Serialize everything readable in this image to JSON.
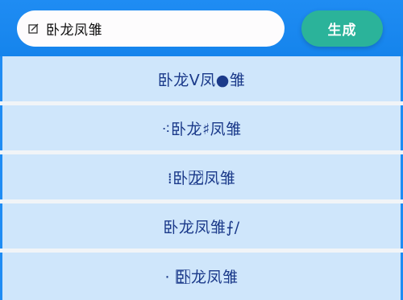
{
  "search": {
    "value": "卧龙凤雏"
  },
  "generate_button": {
    "label": "生成"
  },
  "results": [
    {
      "text": "卧龙ᐯ凤●雏"
    },
    {
      "text": "⁖卧龙♯凤雏"
    },
    {
      "text": "⁞卧龙⃞凤雏"
    },
    {
      "text": "卧龙凤雏⨍/"
    },
    {
      "text": "· 卧⃞龙凤雏"
    }
  ],
  "colors": {
    "header_blue": "#1f8cf3",
    "button_teal": "#2bb39a",
    "row_bg": "#cfe6fb",
    "row_text": "#1b3a8a"
  }
}
